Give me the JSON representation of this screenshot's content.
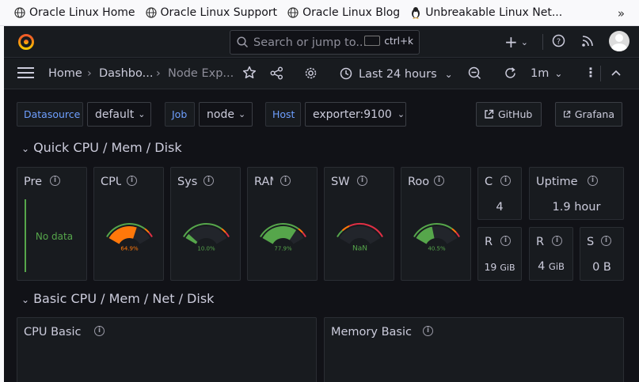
{
  "bookmarks": [
    {
      "label": "Oracle Linux Home",
      "icon": "globe-icon"
    },
    {
      "label": "Oracle Linux Support",
      "icon": "globe-icon"
    },
    {
      "label": "Oracle Linux Blog",
      "icon": "globe-icon"
    },
    {
      "label": "Unbreakable Linux Net...",
      "icon": "penguin-icon"
    }
  ],
  "topbar": {
    "search_placeholder": "Search or jump to...",
    "shortcut": "ctrl+k"
  },
  "nav": {
    "crumb_home": "Home",
    "crumb_dashboards": "Dashbo...",
    "crumb_current": "Node Exp...",
    "time_range": "Last 24 hours",
    "refresh_interval": "1m"
  },
  "variables": {
    "datasource_label": "Datasource",
    "datasource_value": "default",
    "job_label": "Job",
    "job_value": "node",
    "host_label": "Host",
    "host_value": "exporter:9100",
    "link_github": "GitHub",
    "link_grafana": "Grafana"
  },
  "rows": {
    "quick": "Quick CPU / Mem / Disk",
    "basic": "Basic CPU / Mem / Net / Disk"
  },
  "panels": {
    "pressure": {
      "title": "Pre",
      "value": "No data"
    },
    "cpu": {
      "title": "CPU",
      "value": "64.9%",
      "fraction": 0.649
    },
    "sysload": {
      "title": "Sys",
      "value": "10.0%",
      "fraction": 0.1
    },
    "ram": {
      "title": "RAM",
      "value": "77.9%",
      "fraction": 0.779
    },
    "swap": {
      "title": "SW",
      "value": "NaN",
      "fraction": 0
    },
    "rootfs": {
      "title": "Roo",
      "value": "40.5%",
      "fraction": 0.405
    },
    "cores": {
      "title": "C",
      "value": "4"
    },
    "uptime": {
      "title": "Uptime",
      "value": "1.9 hour"
    },
    "ram_total": {
      "title": "R",
      "value": "19",
      "unit": "GiB"
    },
    "rootfs_total": {
      "title": "R",
      "value": "4",
      "unit": "GiB"
    },
    "swap_total": {
      "title": "S",
      "value": "0 B"
    },
    "cpu_basic": {
      "title": "CPU Basic"
    },
    "memory_basic": {
      "title": "Memory Basic"
    }
  },
  "colors": {
    "green": "#56a64b",
    "orange": "#ff780a",
    "red": "#e02f44",
    "dim_green": "#2d7a2d"
  }
}
